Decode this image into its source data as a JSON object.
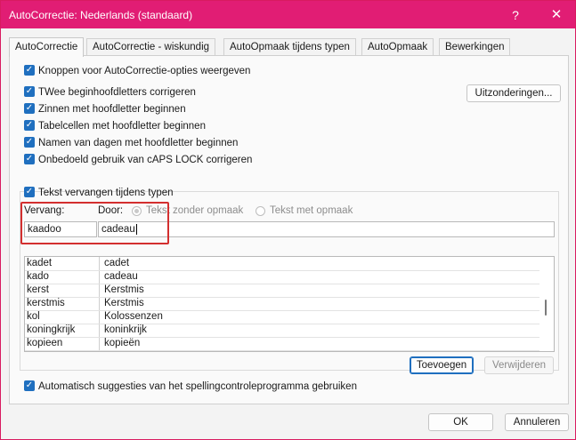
{
  "window": {
    "title": "AutoCorrectie: Nederlands (standaard)",
    "help": "?",
    "close": "✕"
  },
  "tabs": [
    {
      "label": "AutoCorrectie"
    },
    {
      "label": "AutoCorrectie - wiskundig"
    },
    {
      "label": "AutoOpmaak tijdens typen"
    },
    {
      "label": "AutoOpmaak"
    },
    {
      "label": "Bewerkingen"
    }
  ],
  "options": {
    "show_buttons": "Knoppen voor AutoCorrectie-opties weergeven",
    "two_caps": "TWee beginhoofdletters corrigeren",
    "sentences": "Zinnen met hoofdletter beginnen",
    "table_cells": "Tabelcellen met hoofdletter beginnen",
    "day_names": "Namen van dagen met hoofdletter beginnen",
    "caps_lock": "Onbedoeld gebruik van cAPS LOCK corrigeren",
    "exceptions_button": "Uitzonderingen...",
    "replace_text": "Tekst vervangen tijdens typen"
  },
  "replace": {
    "vervang_label": "Vervang:",
    "door_label": "Door:",
    "radio_plain": "Tekst zonder opmaak",
    "radio_formatted": "Tekst met opmaak",
    "vervang_value": "kaadoo",
    "door_value": "cadeau"
  },
  "entries": [
    {
      "from": "kadet",
      "to": "cadet"
    },
    {
      "from": "kado",
      "to": "cadeau"
    },
    {
      "from": "kerst",
      "to": "Kerstmis"
    },
    {
      "from": "kerstmis",
      "to": "Kerstmis"
    },
    {
      "from": "kol",
      "to": "Kolossenzen"
    },
    {
      "from": "koningkrijk",
      "to": "koninkrijk"
    },
    {
      "from": "kopieen",
      "to": "kopieën"
    }
  ],
  "buttons": {
    "add": "Toevoegen",
    "delete": "Verwijderen",
    "ok": "OK",
    "cancel": "Annuleren"
  },
  "suggestions": "Automatisch suggesties van het spellingcontroleprogramma gebruiken"
}
